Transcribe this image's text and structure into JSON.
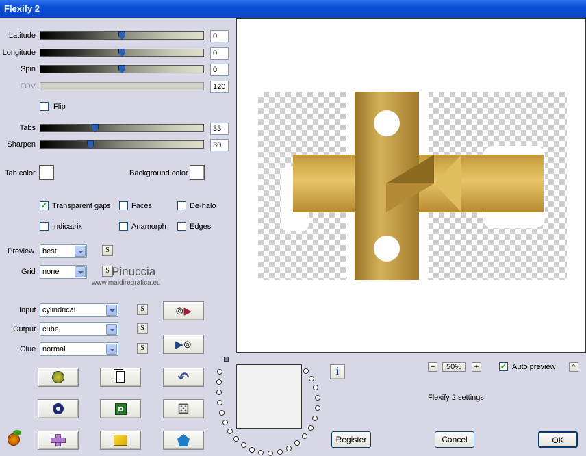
{
  "window": {
    "title": "Flexify 2"
  },
  "sliders": {
    "latitude": {
      "label": "Latitude",
      "value": "0"
    },
    "longitude": {
      "label": "Longitude",
      "value": "0"
    },
    "spin": {
      "label": "Spin",
      "value": "0"
    },
    "fov": {
      "label": "FOV",
      "value": "120"
    },
    "tabs": {
      "label": "Tabs",
      "value": "33"
    },
    "sharpen": {
      "label": "Sharpen",
      "value": "30"
    }
  },
  "flip_label": "Flip",
  "colors": {
    "tab_color_label": "Tab color",
    "background_color_label": "Background color",
    "tab_color": "#ffffff",
    "background_color": "#ffffff"
  },
  "options": {
    "transparent_gaps": {
      "label": "Transparent gaps",
      "checked": true
    },
    "faces": {
      "label": "Faces",
      "checked": false
    },
    "de_halo": {
      "label": "De-halo",
      "checked": false
    },
    "indicatrix": {
      "label": "Indicatrix",
      "checked": false
    },
    "anamorph": {
      "label": "Anamorph",
      "checked": false
    },
    "edges": {
      "label": "Edges",
      "checked": false
    }
  },
  "preview_select": {
    "label": "Preview",
    "value": "best"
  },
  "grid_select": {
    "label": "Grid",
    "value": "none"
  },
  "input_select": {
    "label": "Input",
    "value": "cylindrical"
  },
  "output_select": {
    "label": "Output",
    "value": "cube"
  },
  "glue_select": {
    "label": "Glue",
    "value": "normal"
  },
  "s_button_label": "S",
  "watermark": {
    "name": "Pinuccia",
    "url": "www.maidiregrafica.eu"
  },
  "zoom": {
    "value": "50%",
    "minus": "−",
    "plus": "+"
  },
  "auto_preview": {
    "label": "Auto preview",
    "checked": true
  },
  "settings_name": "Flexify 2 settings",
  "buttons": {
    "register": "Register",
    "cancel": "Cancel",
    "ok": "OK",
    "info": "i",
    "collapse": "^"
  }
}
